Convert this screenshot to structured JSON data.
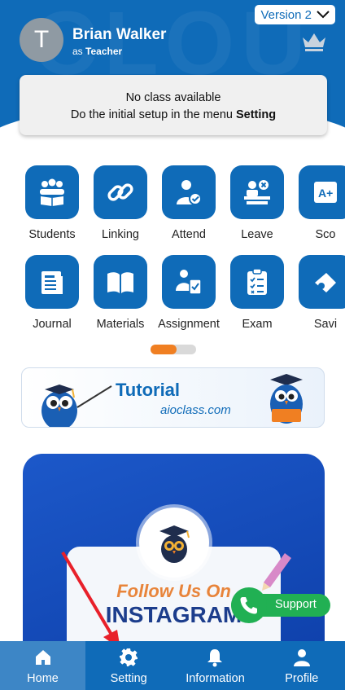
{
  "header": {
    "avatar_letter": "T",
    "user_name": "Brian Walker",
    "role_prefix": "as",
    "role": "Teacher",
    "version_label": "Version 2",
    "brand_color": "#0f6bb8"
  },
  "notice": {
    "line1": "No class available",
    "line2_prefix": "Do the initial setup in the menu",
    "line2_bold": "Setting"
  },
  "menu": [
    {
      "label": "Students",
      "icon": "students-icon"
    },
    {
      "label": "Linking",
      "icon": "link-icon"
    },
    {
      "label": "Attend",
      "icon": "attend-icon"
    },
    {
      "label": "Leave",
      "icon": "leave-icon"
    },
    {
      "label": "Sco",
      "icon": "score-icon"
    },
    {
      "label": "Journal",
      "icon": "journal-icon"
    },
    {
      "label": "Materials",
      "icon": "book-icon"
    },
    {
      "label": "Assignment",
      "icon": "assignment-icon"
    },
    {
      "label": "Exam",
      "icon": "exam-icon"
    },
    {
      "label": "Savi",
      "icon": "savings-icon"
    }
  ],
  "banner": {
    "title": "Tutorial",
    "subtitle": "aioclass.com"
  },
  "instagram": {
    "follow_text": "Follow Us On",
    "title": "INSTAGRAM"
  },
  "support": {
    "label": "Support",
    "color": "#21b053"
  },
  "bottom_nav": [
    {
      "label": "Home",
      "icon": "home-icon",
      "active": true
    },
    {
      "label": "Setting",
      "icon": "gear-icon",
      "active": false
    },
    {
      "label": "Information",
      "icon": "bell-icon",
      "active": false
    },
    {
      "label": "Profile",
      "icon": "person-icon",
      "active": false
    }
  ],
  "accent_orange": "#f07f22"
}
